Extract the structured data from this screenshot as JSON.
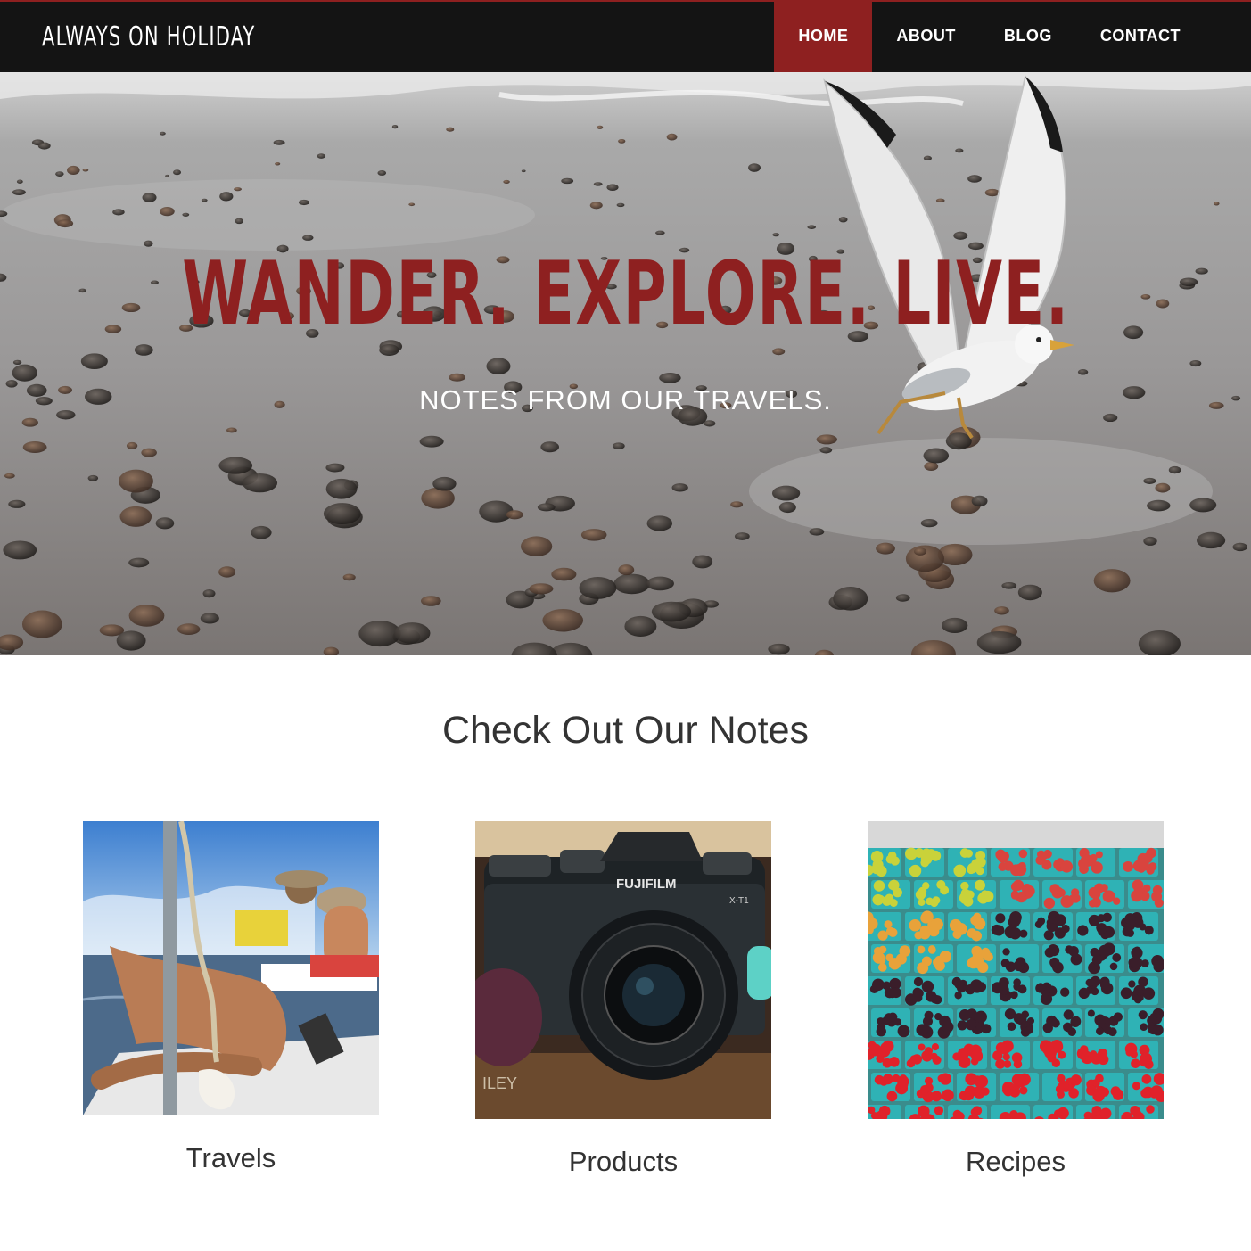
{
  "header": {
    "brand": "ALWAYS ON HOLIDAY",
    "nav": [
      {
        "label": "HOME",
        "active": true
      },
      {
        "label": "ABOUT",
        "active": false
      },
      {
        "label": "BLOG",
        "active": false
      },
      {
        "label": "CONTACT",
        "active": false
      }
    ]
  },
  "hero": {
    "title": "WANDER. EXPLORE. LIVE.",
    "subtitle": "NOTES FROM OUR TRAVELS."
  },
  "notes": {
    "heading": "Check Out Our Notes",
    "cards": [
      {
        "caption": "Travels",
        "image": "boat-travel-photo"
      },
      {
        "caption": "Products",
        "image": "fujifilm-camera-photo",
        "camera_brand": "FUJIFILM",
        "camera_model": "X-T1"
      },
      {
        "caption": "Recipes",
        "image": "market-berries-photo"
      }
    ]
  },
  "colors": {
    "accent": "#8e2020",
    "navbar": "#141414",
    "text": "#333333"
  }
}
